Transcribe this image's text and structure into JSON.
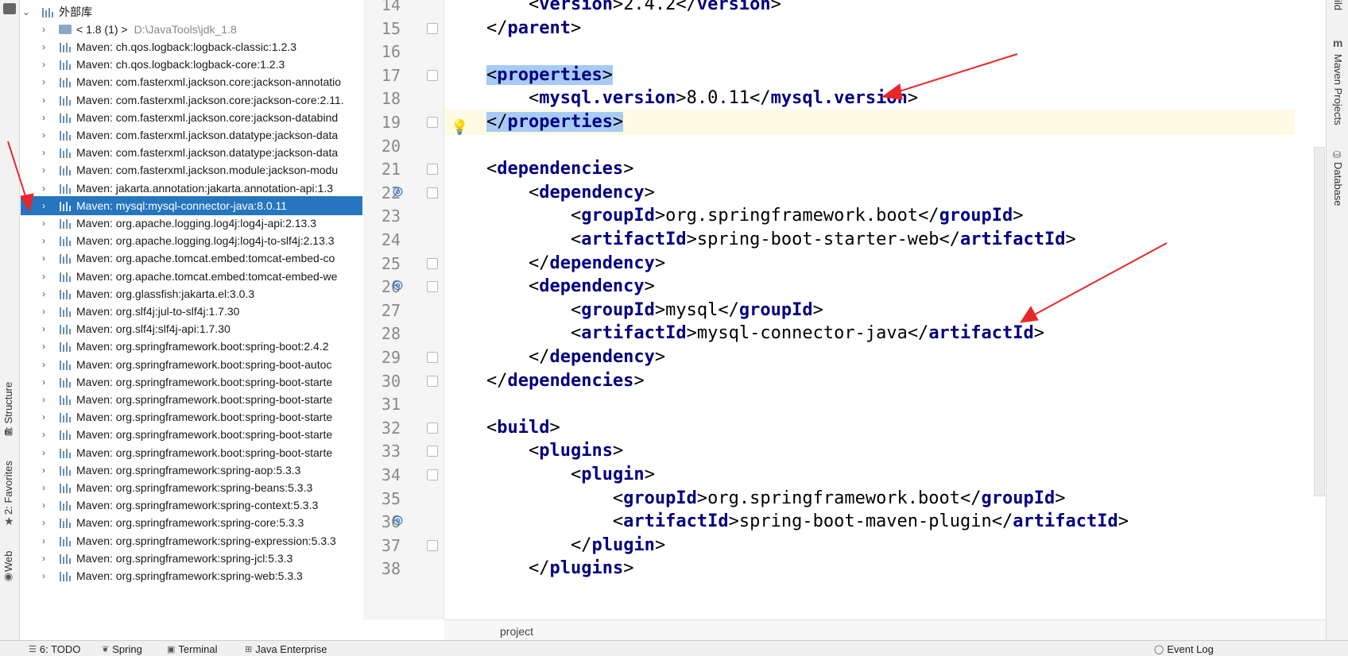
{
  "left_strip": {
    "tabs": [
      {
        "label": "7: Structure",
        "icon": "structure-icon"
      },
      {
        "label": "2: Favorites",
        "icon": "star-icon"
      },
      {
        "label": "Web",
        "icon": "web-icon"
      }
    ]
  },
  "project_tree": {
    "root_label": "外部库",
    "jdk": {
      "label": "< 1.8 (1) >",
      "path": "D:\\JavaTools\\jdk_1.8"
    },
    "items": [
      "Maven: ch.qos.logback:logback-classic:1.2.3",
      "Maven: ch.qos.logback:logback-core:1.2.3",
      "Maven: com.fasterxml.jackson.core:jackson-annotatio",
      "Maven: com.fasterxml.jackson.core:jackson-core:2.11.",
      "Maven: com.fasterxml.jackson.core:jackson-databind",
      "Maven: com.fasterxml.jackson.datatype:jackson-data",
      "Maven: com.fasterxml.jackson.datatype:jackson-data",
      "Maven: com.fasterxml.jackson.module:jackson-modu",
      "Maven: jakarta.annotation:jakarta.annotation-api:1.3",
      "Maven: mysql:mysql-connector-java:8.0.11",
      "Maven: org.apache.logging.log4j:log4j-api:2.13.3",
      "Maven: org.apache.logging.log4j:log4j-to-slf4j:2.13.3",
      "Maven: org.apache.tomcat.embed:tomcat-embed-co",
      "Maven: org.apache.tomcat.embed:tomcat-embed-we",
      "Maven: org.glassfish:jakarta.el:3.0.3",
      "Maven: org.slf4j:jul-to-slf4j:1.7.30",
      "Maven: org.slf4j:slf4j-api:1.7.30",
      "Maven: org.springframework.boot:spring-boot:2.4.2",
      "Maven: org.springframework.boot:spring-boot-autoc",
      "Maven: org.springframework.boot:spring-boot-starte",
      "Maven: org.springframework.boot:spring-boot-starte",
      "Maven: org.springframework.boot:spring-boot-starte",
      "Maven: org.springframework.boot:spring-boot-starte",
      "Maven: org.springframework.boot:spring-boot-starte",
      "Maven: org.springframework:spring-aop:5.3.3",
      "Maven: org.springframework:spring-beans:5.3.3",
      "Maven: org.springframework:spring-context:5.3.3",
      "Maven: org.springframework:spring-core:5.3.3",
      "Maven: org.springframework:spring-expression:5.3.3",
      "Maven: org.springframework:spring-jcl:5.3.3",
      "Maven: org.springframework:spring-web:5.3.3"
    ],
    "selected_index": 9
  },
  "editor": {
    "lines": [
      {
        "n": "14",
        "code": "        <version>2.4.2</version>"
      },
      {
        "n": "15",
        "code": "    </parent>"
      },
      {
        "n": "16",
        "code": ""
      },
      {
        "n": "17",
        "code": "    <properties>"
      },
      {
        "n": "18",
        "code": "        <mysql.version>8.0.11</mysql.version>"
      },
      {
        "n": "19",
        "code": "    </properties>"
      },
      {
        "n": "20",
        "code": ""
      },
      {
        "n": "21",
        "code": "    <dependencies>"
      },
      {
        "n": "22",
        "code": "        <dependency>"
      },
      {
        "n": "23",
        "code": "            <groupId>org.springframework.boot</groupId>"
      },
      {
        "n": "24",
        "code": "            <artifactId>spring-boot-starter-web</artifactId>"
      },
      {
        "n": "25",
        "code": "        </dependency>"
      },
      {
        "n": "26",
        "code": "        <dependency>"
      },
      {
        "n": "27",
        "code": "            <groupId>mysql</groupId>"
      },
      {
        "n": "28",
        "code": "            <artifactId>mysql-connector-java</artifactId>"
      },
      {
        "n": "29",
        "code": "        </dependency>"
      },
      {
        "n": "30",
        "code": "    </dependencies>"
      },
      {
        "n": "31",
        "code": ""
      },
      {
        "n": "32",
        "code": "    <build>"
      },
      {
        "n": "33",
        "code": "        <plugins>"
      },
      {
        "n": "34",
        "code": "            <plugin>"
      },
      {
        "n": "35",
        "code": "                <groupId>org.springframework.boot</groupId>"
      },
      {
        "n": "36",
        "code": "                <artifactId>spring-boot-maven-plugin</artifactId>"
      },
      {
        "n": "37",
        "code": "            </plugin>"
      },
      {
        "n": "38",
        "code": "        </plugins>"
      }
    ],
    "breadcrumb": "project"
  },
  "right_strip": {
    "tabs": [
      {
        "label": "ild"
      },
      {
        "label": "Maven Projects"
      },
      {
        "label": "Database"
      }
    ]
  },
  "bottom_bar": {
    "tabs": [
      {
        "label": "6: TODO",
        "icon": "todo-icon"
      },
      {
        "label": "Spring",
        "icon": "spring-icon"
      },
      {
        "label": "Terminal",
        "icon": "terminal-icon"
      },
      {
        "label": "Java Enterprise",
        "icon": "java-enterprise-icon"
      }
    ],
    "event_log": "Event Log"
  },
  "colors": {
    "tag": "#000080",
    "selection": "#2675bf",
    "annotation_arrow": "#e8272b"
  }
}
